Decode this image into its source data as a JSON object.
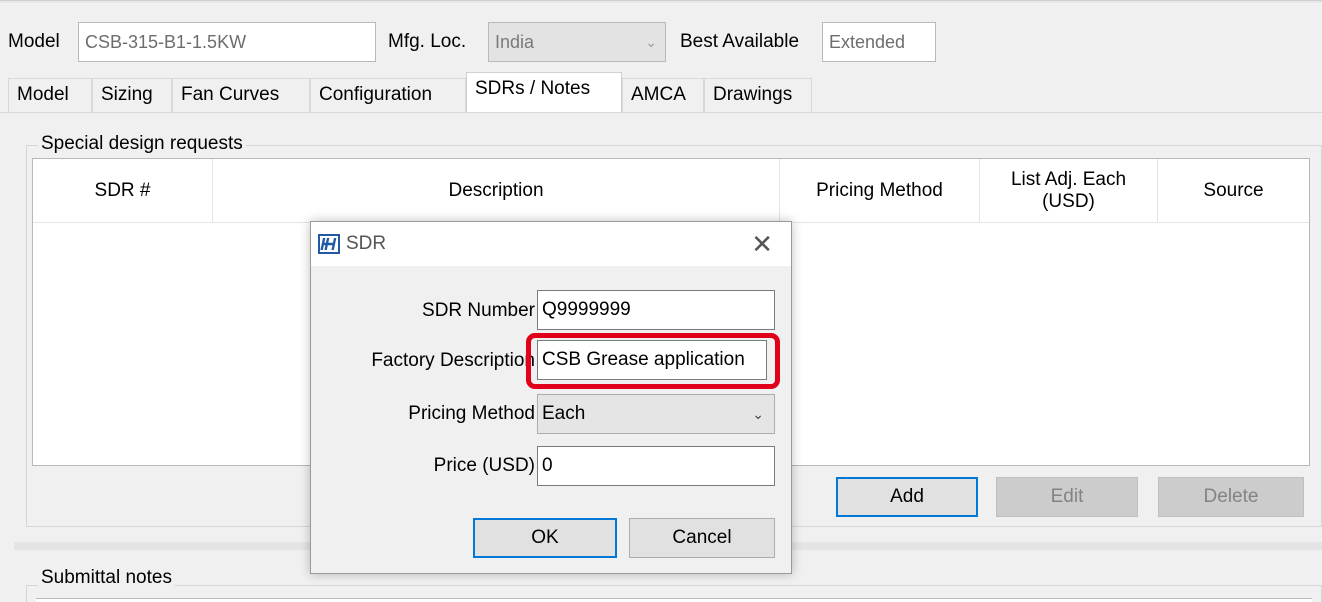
{
  "header": {
    "model_label": "Model",
    "model_value": "CSB-315-B1-1.5KW",
    "mfg_label": "Mfg. Loc.",
    "mfg_value": "India",
    "best_label": "Best Available",
    "best_value": "Extended"
  },
  "tabs": [
    {
      "label": "Model"
    },
    {
      "label": "Sizing"
    },
    {
      "label": "Fan Curves"
    },
    {
      "label": "Configuration"
    },
    {
      "label": "SDRs / Notes"
    },
    {
      "label": "AMCA"
    },
    {
      "label": "Drawings"
    }
  ],
  "active_tab": "SDRs / Notes",
  "sdr_group": {
    "title": "Special design requests",
    "columns": [
      "SDR #",
      "Description",
      "Pricing Method",
      "List Adj. Each (USD)",
      "Source"
    ],
    "rows": [],
    "add_label": "Add",
    "edit_label": "Edit",
    "delete_label": "Delete"
  },
  "notes_group": {
    "title": "Submittal notes"
  },
  "dialog": {
    "title": "SDR",
    "icon": "app-logo-icon",
    "fields": {
      "sdr_number_label": "SDR Number",
      "sdr_number_value": "Q9999999",
      "factory_desc_label": "Factory Description",
      "factory_desc_value": "CSB Grease application",
      "pricing_label": "Pricing Method",
      "pricing_value": "Each",
      "price_label": "Price (USD)",
      "price_value": "0"
    },
    "ok_label": "OK",
    "cancel_label": "Cancel"
  },
  "colors": {
    "highlight": "#e0001a",
    "default_button_border": "#0078d7",
    "window_bg": "#f0f0f0"
  }
}
